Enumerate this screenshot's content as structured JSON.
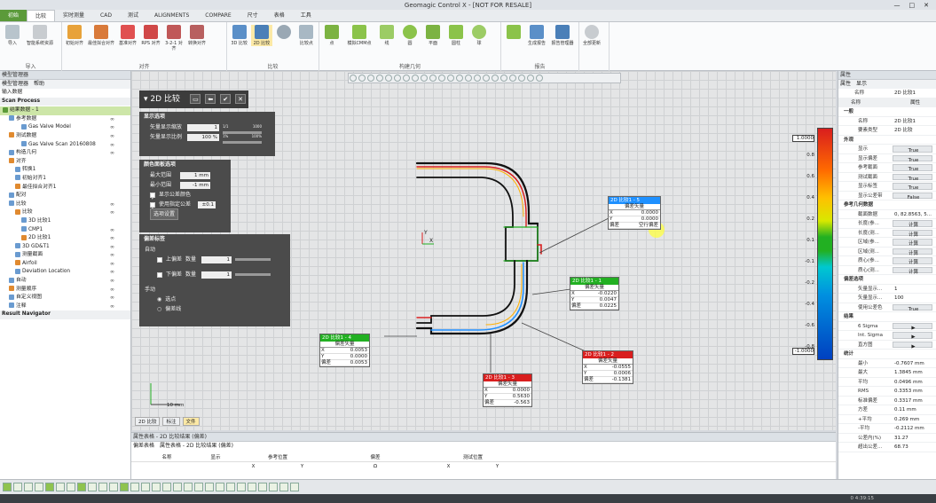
{
  "window": {
    "title": "Geomagic Control X - [NOT FOR RESALE]"
  },
  "ribbon_tabs": [
    "初始",
    "比较",
    "实时测量",
    "CAD",
    "测试",
    "ALIGNMENTS",
    "COMPARE",
    "尺寸",
    "表格",
    "工具"
  ],
  "ribbon_groups": [
    {
      "label": "导入",
      "buttons": [
        "导入",
        "智能系统资源"
      ]
    },
    {
      "label": "对齐",
      "buttons": [
        "初始对齐",
        "最佳拟合对齐",
        "基准对齐",
        "RPS 对齐",
        "3-2-1 对齐",
        "转换对齐"
      ]
    },
    {
      "label": "比较",
      "buttons": [
        "3D 比较",
        "2D 比较",
        "",
        "比较点"
      ]
    },
    {
      "label": "构建几何",
      "buttons": [
        "点",
        "模拟CMM点",
        "线",
        "圆",
        "平面",
        "圆柱",
        "球"
      ]
    },
    {
      "label": "报告",
      "buttons": [
        "",
        "生成报告",
        "报告管理器"
      ]
    },
    {
      "label": "全部更新",
      "buttons": [
        "全部更新"
      ]
    }
  ],
  "left_panel": {
    "header": "模型管理器",
    "tabs": [
      "模型管理器",
      "帮助"
    ],
    "section_label": "输入数据",
    "scan_process": "Scan Process",
    "tree": [
      {
        "label": "结果数据 - 1",
        "indent": 0,
        "selected": true,
        "eye": ""
      },
      {
        "label": "参考数据",
        "indent": 1,
        "eye": "∞"
      },
      {
        "label": "Gas Valve Model",
        "indent": 3,
        "eye": "∞"
      },
      {
        "label": "测试数据",
        "indent": 1,
        "eye": "∞"
      },
      {
        "label": "Gas Valve Scan 20160808",
        "indent": 3,
        "eye": "∞"
      },
      {
        "label": "构造几何",
        "indent": 1,
        "eye": "∞"
      },
      {
        "label": "对齐",
        "indent": 1,
        "eye": ""
      },
      {
        "label": "转换1",
        "indent": 2,
        "eye": ""
      },
      {
        "label": "初始对齐1",
        "indent": 2,
        "eye": ""
      },
      {
        "label": "最佳拟合对齐1",
        "indent": 2,
        "eye": ""
      },
      {
        "label": "配对",
        "indent": 1,
        "eye": ""
      },
      {
        "label": "比较",
        "indent": 1,
        "eye": "∞"
      },
      {
        "label": "比较",
        "indent": 2,
        "eye": "∞"
      },
      {
        "label": "3D 比较1",
        "indent": 3,
        "eye": ""
      },
      {
        "label": "CMP1",
        "indent": 3,
        "eye": "∞"
      },
      {
        "label": "2D 比较1",
        "indent": 3,
        "eye": "∞"
      },
      {
        "label": "3D GD&T1",
        "indent": 2,
        "eye": "∞"
      },
      {
        "label": "测量截面",
        "indent": 2,
        "eye": "∞"
      },
      {
        "label": "Airfoil",
        "indent": 2,
        "eye": "∞"
      },
      {
        "label": "Deviation Location",
        "indent": 2,
        "eye": "∞"
      },
      {
        "label": "自动",
        "indent": 1,
        "eye": "∞"
      },
      {
        "label": "测量顺序",
        "indent": 1,
        "eye": "∞"
      },
      {
        "label": "自定义视图",
        "indent": 1,
        "eye": "∞"
      },
      {
        "label": "注释",
        "indent": 1,
        "eye": "∞"
      }
    ],
    "result_navigator": "Result Navigator"
  },
  "dialog": {
    "title": "2D 比较",
    "display_options": {
      "header": "显示选项",
      "arrow_scale": {
        "label": "矢量显示缩放",
        "value": "1",
        "min": "1/1",
        "max": "1000"
      },
      "arrow_ratio": {
        "label": "矢量显示比例",
        "value": "100 %",
        "min": "1%",
        "max": "100%"
      }
    },
    "color_options": {
      "header": "颜色面板选项",
      "max_range": {
        "label": "最大范围",
        "value": "1 mm"
      },
      "min_range": {
        "label": "最小范围",
        "value": "-1 mm"
      },
      "show_tolerance": "显示公差颜色",
      "use_tolerance": {
        "label": "使用指定公差",
        "value": "±0.1"
      },
      "option_button": "选项设置"
    },
    "deviation_labels": {
      "header": "偏差标签",
      "auto": "自动",
      "upper": {
        "label": "上偏差",
        "count_label": "数量",
        "value": "1"
      },
      "lower": {
        "label": "下偏差",
        "count_label": "数量",
        "value": "1"
      },
      "manual": "手动",
      "point": "选点",
      "line": "偏差线"
    }
  },
  "scale_bar": {
    "top": "1.0000",
    "bottom": "-1.0000",
    "ticks": [
      "0.8",
      "0.6",
      "0.4",
      "0.2",
      "0.1",
      "-0.1",
      "-0.2",
      "-0.4",
      "-0.6",
      "-0.8"
    ]
  },
  "callouts": [
    {
      "id": "2D 比较1 - 5",
      "sub": "偏差矢量",
      "header_color": "#1e90ff",
      "rows": [
        [
          "X",
          "0.0000"
        ],
        [
          "Y",
          "0.0000"
        ],
        [
          "偏差",
          "空行偏差"
        ]
      ]
    },
    {
      "id": "2D 比较1 - 1",
      "sub": "偏差矢量",
      "header_color": "#22b022",
      "rows": [
        [
          "X",
          "-0.0220"
        ],
        [
          "Y",
          "0.0047"
        ],
        [
          "偏差",
          "0.0225"
        ]
      ]
    },
    {
      "id": "2D 比较1 - 4",
      "sub": "偏差矢量",
      "header_color": "#22b022",
      "rows": [
        [
          "X",
          "0.0053"
        ],
        [
          "Y",
          "0.0000"
        ],
        [
          "偏差",
          "0.0053"
        ]
      ]
    },
    {
      "id": "2D 比较1 - 2",
      "sub": "偏差矢量",
      "header_color": "#d91e1e",
      "rows": [
        [
          "X",
          "-0.0555"
        ],
        [
          "Y",
          "0.0006"
        ],
        [
          "偏差",
          "-0.1381"
        ]
      ]
    },
    {
      "id": "2D 比较1 - 3",
      "sub": "偏差矢量",
      "header_color": "#d91e1e",
      "rows": [
        [
          "X",
          "0.0000"
        ],
        [
          "Y",
          "0.5630"
        ],
        [
          "偏差",
          "-0.563"
        ]
      ]
    }
  ],
  "viewport": {
    "scale_label": "10 mm",
    "bottom_tabs": [
      "2D 比较",
      "标注",
      "文件"
    ],
    "axis_x": "X",
    "axis_y": "Y"
  },
  "right_panel": {
    "header": "属性",
    "tabs": [
      "属性",
      "显示"
    ],
    "name_row": {
      "label": "名称",
      "value": "2D 比较1"
    },
    "col_headers": [
      "名称",
      "属性"
    ],
    "sections": [
      {
        "title": "一般",
        "rows": [
          [
            "名称",
            "2D 比较1"
          ],
          [
            "要素类型",
            "2D 比较"
          ]
        ]
      },
      {
        "title": "外观",
        "rows": [
          [
            "显示",
            "True"
          ],
          [
            "显示偏差",
            "True"
          ],
          [
            "参考截面",
            "True"
          ],
          [
            "测试截面",
            "True"
          ],
          [
            "显示标签",
            "True"
          ],
          [
            "显示公差带",
            "False"
          ]
        ]
      },
      {
        "title": "参考几何数据",
        "rows": [
          [
            "截面数据",
            "0, 82.8563, 5..."
          ],
          [
            "长度(参...",
            "计算"
          ],
          [
            "长度(测...",
            "计算"
          ],
          [
            "区域(参...",
            "计算"
          ],
          [
            "区域(测...",
            "计算"
          ],
          [
            "质心(参...",
            "计算"
          ],
          [
            "质心(测...",
            "计算"
          ]
        ]
      },
      {
        "title": "偏差选项",
        "rows": [
          [
            "矢量显示...",
            "1"
          ],
          [
            "矢量显示...",
            "100"
          ],
          [
            "使用公差色",
            "True"
          ]
        ]
      },
      {
        "title": "结果",
        "rows": [
          [
            "6 Sigma",
            "▶"
          ],
          [
            "Int. Sigma",
            "▶"
          ],
          [
            "直方图",
            "▶"
          ]
        ]
      },
      {
        "title": "统计",
        "rows": [
          [
            "最小",
            "-0.7607 mm"
          ],
          [
            "最大",
            "1.3845 mm"
          ],
          [
            "平均",
            "0.0496 mm"
          ],
          [
            "RMS",
            "0.3353 mm"
          ],
          [
            "标准偏差",
            "0.3317 mm"
          ],
          [
            "方差",
            "0.11 mm"
          ],
          [
            "+平均",
            "0.269 mm"
          ],
          [
            "-平均",
            "-0.2112 mm"
          ],
          [
            "公差内(%)",
            "31.27"
          ],
          [
            "超出公差...",
            "68.73"
          ]
        ]
      }
    ]
  },
  "bottom_panel": {
    "header": "属性表格 - 2D 比较结果 (偏差)",
    "tabs": [
      "偏差表格",
      "属性表格 - 2D 比较结果 (偏差)"
    ],
    "columns": [
      "名称",
      "显示",
      "参考位置",
      "偏差",
      "测试位置"
    ],
    "sub_columns": [
      "X",
      "Y",
      "Ω",
      "X",
      "Y"
    ]
  },
  "status": {
    "coords": "0 4:39:15"
  }
}
